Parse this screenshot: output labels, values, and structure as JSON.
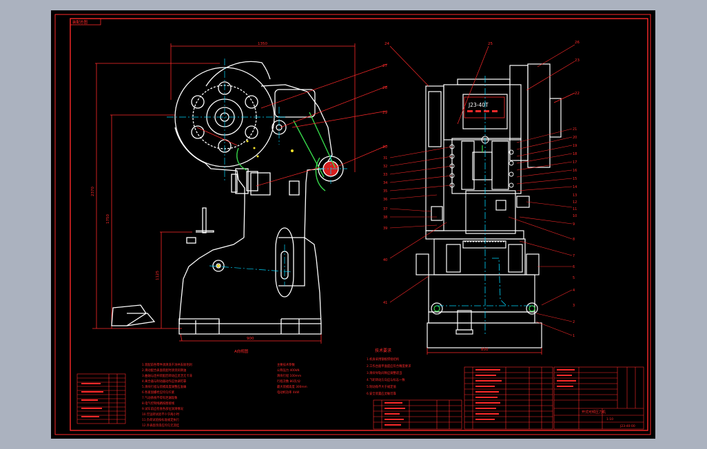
{
  "drawing": {
    "corner_label": "装配总图",
    "model_label": "J23-40T",
    "dim_left_width": "1350",
    "dim_left_h1": "2370",
    "dim_left_h2": "1750",
    "dim_left_h3": "1125",
    "dim_left_base": "900",
    "dim_right_base": "850",
    "view_caption": "A向视图",
    "left_callouts": [
      "27",
      "28",
      "29",
      "30"
    ],
    "right_top_callouts": [
      "24",
      "25",
      "26",
      "23",
      "22"
    ],
    "right_side_callouts": [
      "21",
      "20",
      "19",
      "18",
      "17",
      "16",
      "15",
      "14",
      "13",
      "12",
      "11",
      "10",
      "9",
      "8",
      "7",
      "6",
      "5",
      "4",
      "3",
      "2",
      "1"
    ],
    "left_side_callouts": [
      "31",
      "32",
      "33",
      "34",
      "35",
      "36",
      "37",
      "38",
      "39",
      "40",
      "41",
      "42",
      "43"
    ],
    "notes_title": "技术要求",
    "notes_left": [
      "1.装配前各零件须清洗干净并去除毛刺",
      "2.滑动配合表面装配时须涂润滑油",
      "3.曲轴与连杆装配后转动应灵活无卡滞",
      "4.离合器与制动器动作应协调可靠",
      "5.滑块行程与装模高度调整应准确",
      "6.各紧固螺栓应均匀拧紧",
      "7.气动系统不得有泄漏现象",
      "8.电气控制线路按图接线",
      "9.试车前应检查各部位润滑情况",
      "10.空运转试验不少于两小时",
      "11.负荷试验按标准规定执行",
      "12.外表面涂漆应均匀无流挂"
    ],
    "notes_mid": [
      "主要技术参数",
      "公称压力 400kN",
      "滑块行程 100mm",
      "行程次数 80次/分",
      "最大装模高度 300mm",
      "电动机功率 4kW"
    ],
    "notes_right": [
      "1.机身采用钢板焊接结构",
      "2.工作台面平面度应符合精度要求",
      "3.滑块导轨间隙应调整适当",
      "4.飞轮转动方向应与标志一致",
      "5.制动角不大于规定值",
      "6.安全装置应灵敏可靠"
    ],
    "title_block": {
      "name": "开式可倾压力机",
      "scale": "1:10",
      "drawing_no": "J23-40-00"
    }
  },
  "colors": {
    "outline": "#ffffff",
    "dim": "#ff2a2a",
    "center": "#00d8ff",
    "green": "#37d94b",
    "yellow": "#f5e22a",
    "border": "#ff2a2a"
  }
}
